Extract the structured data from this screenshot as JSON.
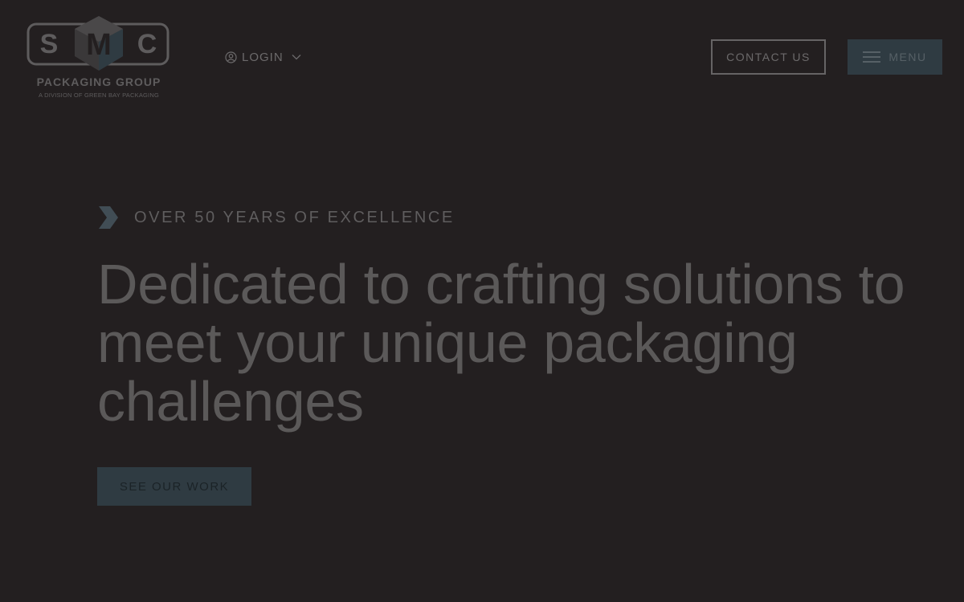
{
  "logo": {
    "letters": [
      "S",
      "M",
      "C"
    ],
    "tagline": "PACKAGING GROUP",
    "subline": "A DIVISION OF GREEN BAY PACKAGING",
    "icon": "cube-logo-icon"
  },
  "nav": {
    "login_label": "LOGIN",
    "login_icon": "user-circle-icon",
    "login_chevron": "chevron-down-icon",
    "contact_label": "CONTACT US",
    "menu_label": "MENU",
    "menu_icon": "hamburger-icon"
  },
  "hero": {
    "eyebrow_icon": "chevron-right-icon",
    "eyebrow": "OVER 50 YEARS OF EXCELLENCE",
    "headline": "Dedicated to crafting solutions to meet your unique packaging challenges",
    "cta_label": "SEE OUR WORK"
  },
  "colors": {
    "background": "#231f20",
    "accent": "#2f3b42",
    "text_muted": "#5b5959"
  }
}
